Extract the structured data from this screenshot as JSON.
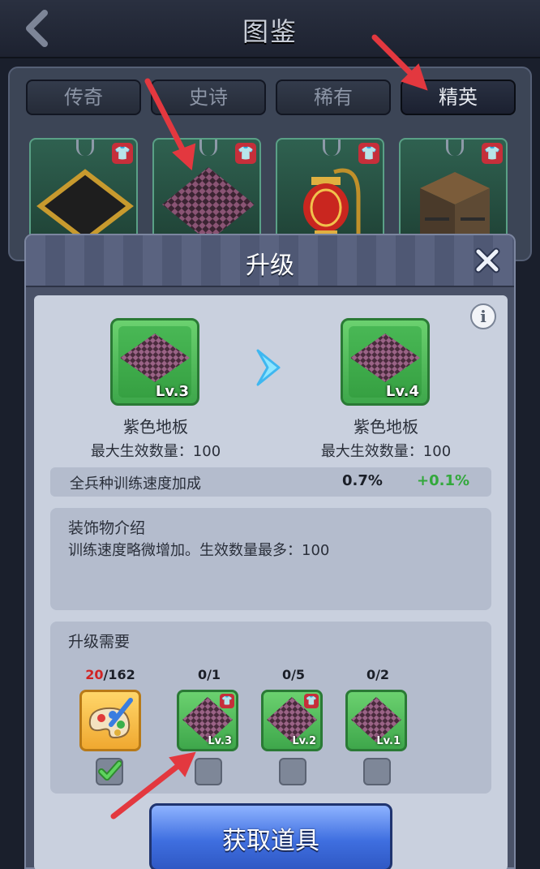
{
  "header": {
    "title": "图鉴"
  },
  "tabs": [
    {
      "label": "传奇"
    },
    {
      "label": "史诗"
    },
    {
      "label": "稀有"
    },
    {
      "label": "精英",
      "active": true
    }
  ],
  "catalog_items": [
    {
      "name": "black-gold-floor-icon"
    },
    {
      "name": "purple-floor-icon"
    },
    {
      "name": "red-lantern-icon"
    },
    {
      "name": "stone-tower-icon"
    }
  ],
  "dialog": {
    "title": "升级",
    "current": {
      "level": "Lv.3",
      "name": "紫色地板",
      "max_label": "最大生效数量：100"
    },
    "next": {
      "level": "Lv.4",
      "name": "紫色地板",
      "max_label": "最大生效数量：100"
    },
    "stat": {
      "name": "全兵种训练速度加成",
      "current": "0.7%",
      "increase": "+0.1%"
    },
    "description": {
      "title": "装饰物介绍",
      "text": "训练速度略微增加。生效数量最多：100"
    },
    "requirements": {
      "title": "升级需要",
      "paint": {
        "have": "20",
        "need": "/162",
        "checked": true
      },
      "items": [
        {
          "count": "0/1",
          "level": "Lv.3"
        },
        {
          "count": "0/5",
          "level": "Lv.2"
        },
        {
          "count": "0/2",
          "level": "Lv.1"
        }
      ]
    },
    "get_button": "获取道具"
  },
  "colors": {
    "accent_green": "#3ea74b",
    "button_blue": "#3f6fe0",
    "arrow_red": "#e3383f"
  }
}
